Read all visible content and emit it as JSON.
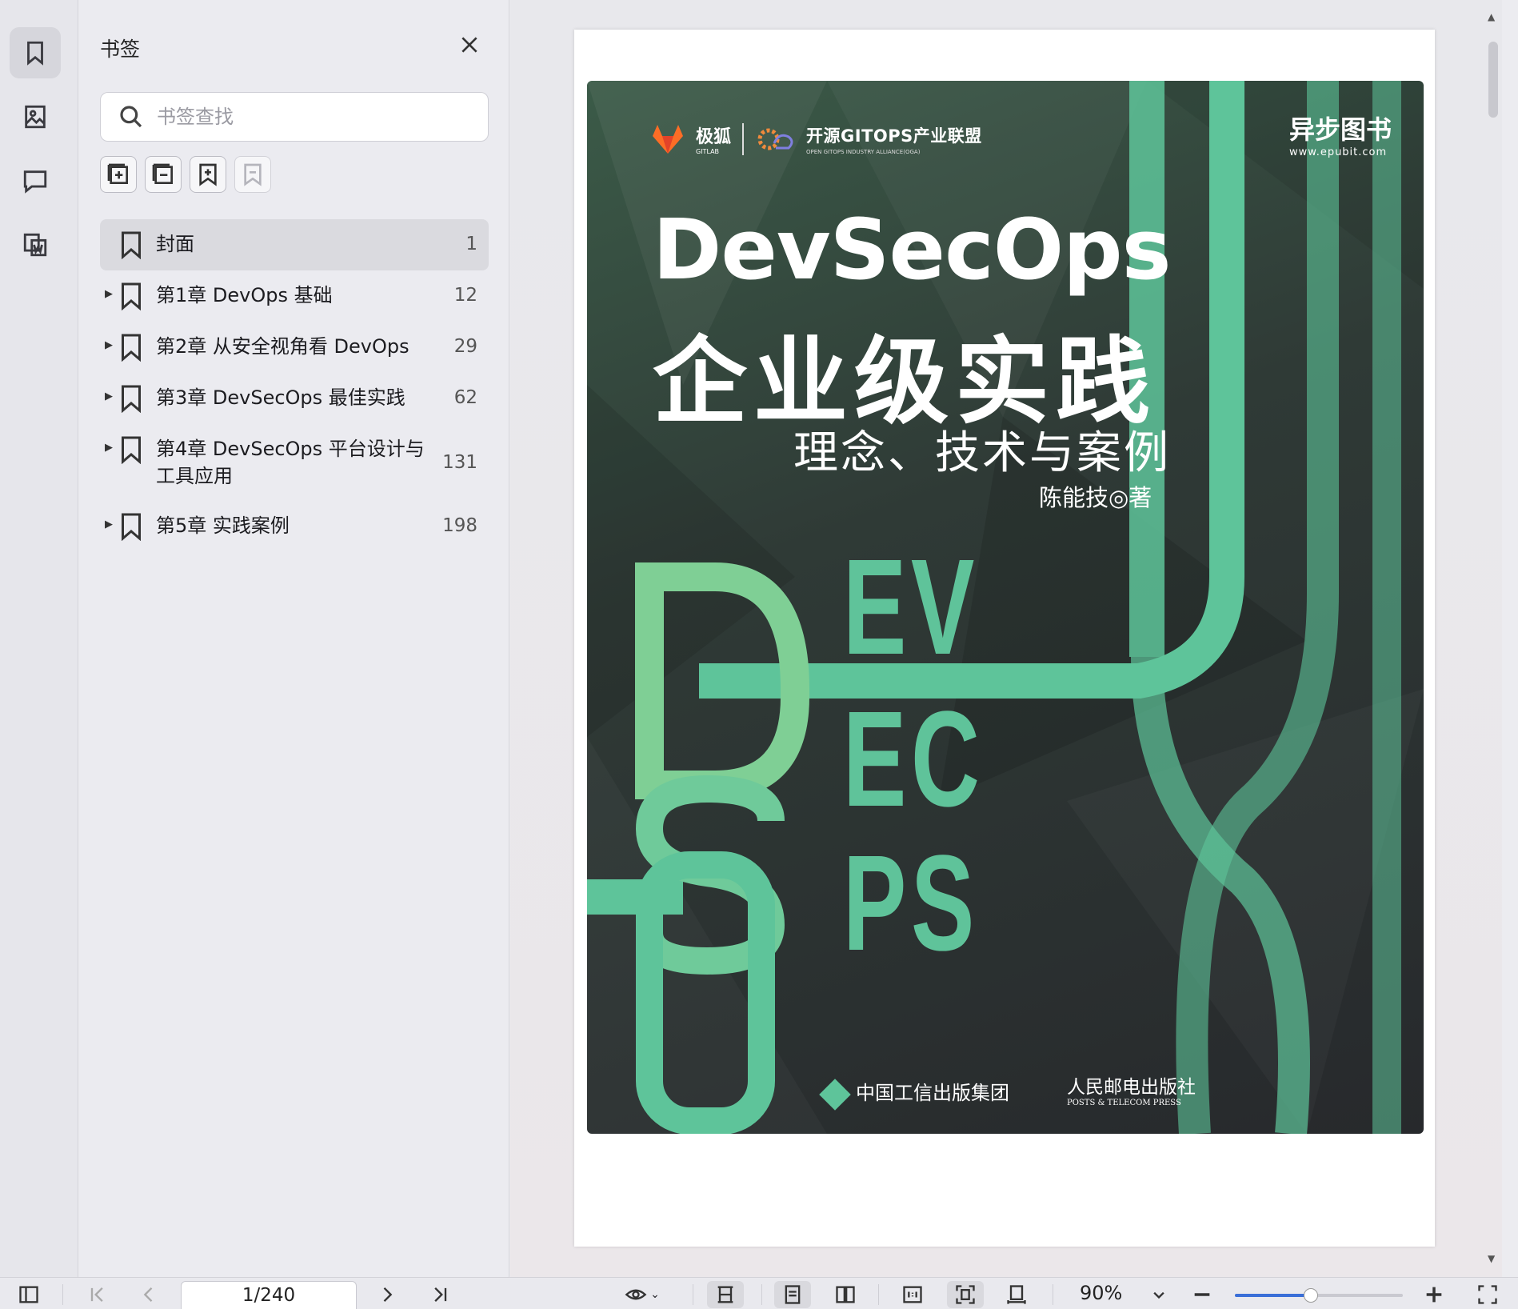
{
  "panel": {
    "title": "书签",
    "search_placeholder": "书签查找"
  },
  "bookmarks": [
    {
      "title": "封面",
      "page": "1",
      "expandable": false,
      "selected": true
    },
    {
      "title": "第1章 DevOps 基础",
      "page": "12",
      "expandable": true
    },
    {
      "title": "第2章 从安全视角看 DevOps",
      "page": "29",
      "expandable": true
    },
    {
      "title": "第3章 DevSecOps 最佳实践",
      "page": "62",
      "expandable": true
    },
    {
      "title": "第4章 DevSecOps 平台设计与工具应用",
      "page": "131",
      "expandable": true
    },
    {
      "title": "第5章 实践案例",
      "page": "198",
      "expandable": true
    }
  ],
  "cover": {
    "logo_left": "极狐",
    "logo_left_sub": "GITLAB",
    "logo_alliance": "开源GITOPS产业联盟",
    "logo_alliance_sub": "OPEN GITOPS INDUSTRY ALLIANCE(OGA)",
    "publisher_brand": "异步图书",
    "publisher_url": "www.epubit.com",
    "title_en": "DevSecOps",
    "title_zh": "企业级实践",
    "subtitle": "理念、技术与案例",
    "author": "陈能技◎著",
    "big_letters": [
      "D",
      "E",
      "V",
      "S",
      "E",
      "C",
      "O",
      "P",
      "S"
    ],
    "publisher_group": "中国工信出版集团",
    "publisher_press": "人民邮电出版社",
    "publisher_press_en": "POSTS & TELECOM PRESS"
  },
  "toolbar": {
    "page_indicator": "1/240",
    "zoom": "90%",
    "zoom_level": 0.45
  },
  "colors": {
    "accent": "#3a6fd8",
    "cover_green": "#5ec49a"
  }
}
